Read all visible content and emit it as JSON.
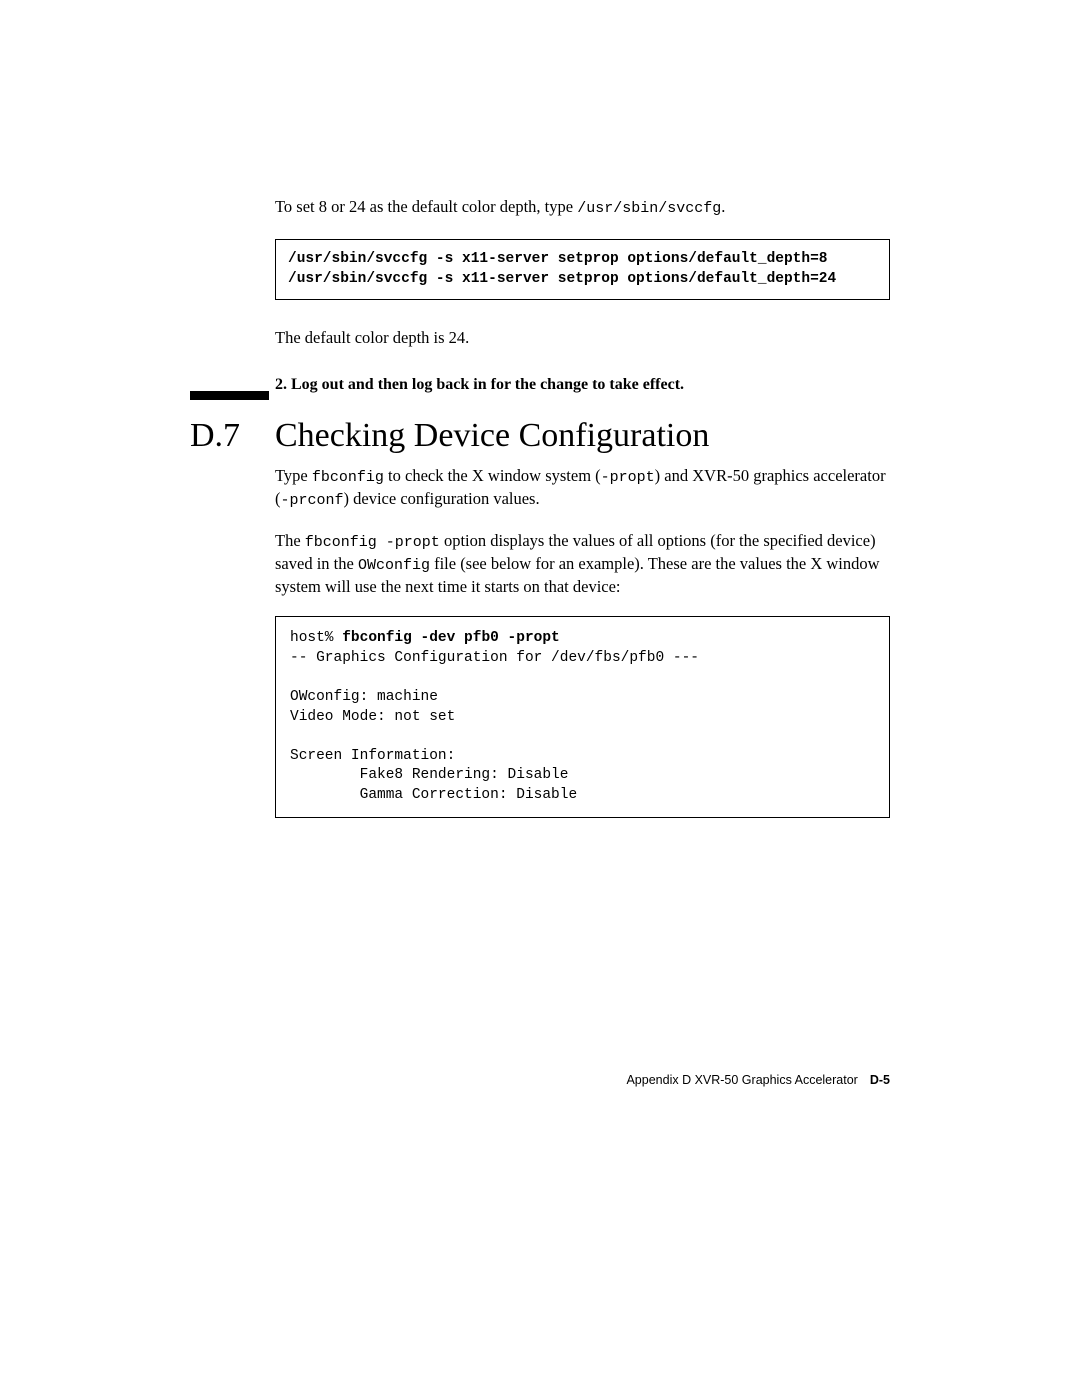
{
  "intro": {
    "prefix": "To set 8 or 24 as the default color depth, type ",
    "cmd": "/usr/sbin/svccfg",
    "suffix": "."
  },
  "codebox1": {
    "line1": "/usr/sbin/svccfg -s x11-server setprop options/default_depth=8",
    "line2": "/usr/sbin/svccfg -s x11-server setprop options/default_depth=24"
  },
  "default_text": "The default color depth is 24.",
  "step2": "2. Log out and then log back in for the change to take effect.",
  "section": {
    "number": "D.7",
    "title": "Checking Device Configuration"
  },
  "para1": {
    "p1": "Type ",
    "c1": "fbconfig",
    "p2": " to check the X window system (",
    "c2": "-propt",
    "p3": ") and XVR-50 graphics accelerator (",
    "c3": "-prconf",
    "p4": ") device configuration values."
  },
  "para2": {
    "p1": "The ",
    "c1": "fbconfig -propt",
    "p2": " option displays the values of all options (for the specified device) saved in the ",
    "c2": "OWconfig",
    "p3": " file (see below for an example). These are the values the X window system will use the next time it starts on that device:"
  },
  "output": {
    "prompt": "host% ",
    "cmd": "fbconfig -dev pfb0 -propt",
    "body": "\n-- Graphics Configuration for /dev/fbs/pfb0 ---\n\nOWconfig: machine\nVideo Mode: not set\n\nScreen Information:\n        Fake8 Rendering: Disable\n        Gamma Correction: Disable"
  },
  "footer": {
    "text": "Appendix D    XVR-50 Graphics Accelerator",
    "page": "D-5"
  }
}
